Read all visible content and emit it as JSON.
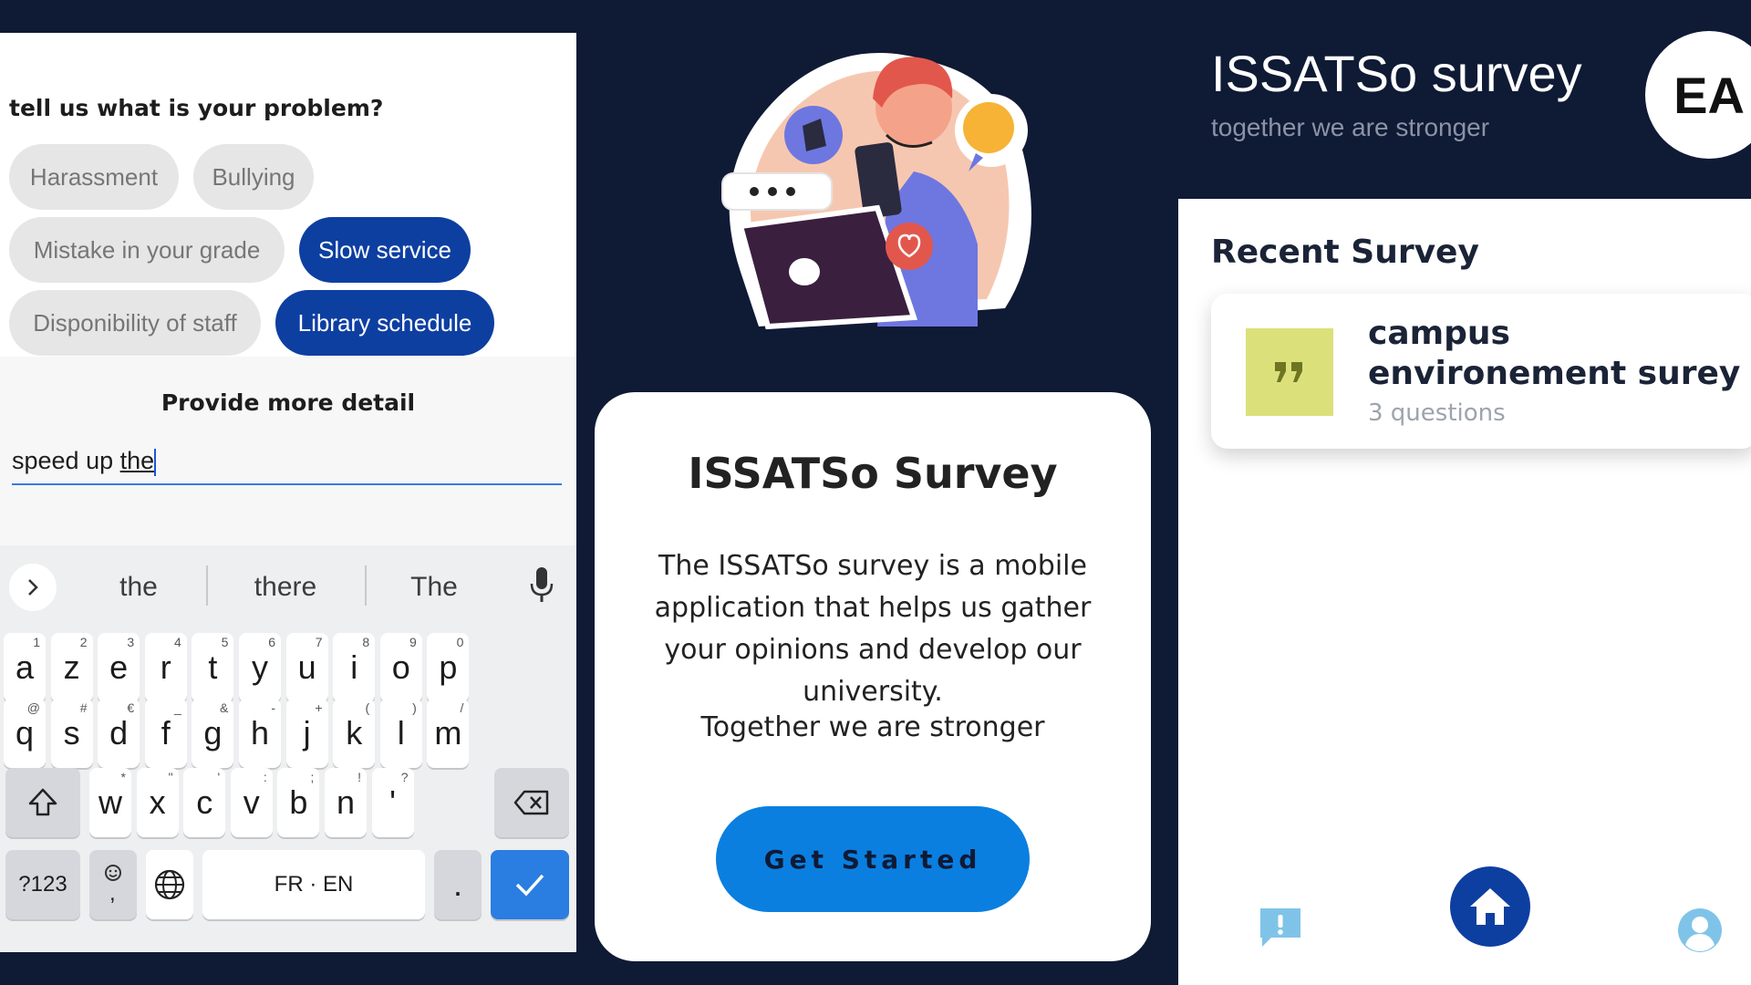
{
  "left": {
    "question": "tell us what is your problem?",
    "chips": [
      {
        "label": "Harassment",
        "selected": false
      },
      {
        "label": "Bullying",
        "selected": false
      },
      {
        "label": "Mistake in your grade",
        "selected": false
      },
      {
        "label": "Slow service",
        "selected": true
      },
      {
        "label": "Disponibility of staff",
        "selected": false
      },
      {
        "label": "Library schedule",
        "selected": true
      }
    ],
    "detail_title": "Provide more detail",
    "detail_value_prefix": "speed up ",
    "detail_value_word": "the",
    "keyboard": {
      "suggestions": [
        "the",
        "there",
        "The"
      ],
      "row1": [
        {
          "k": "a",
          "s": "1"
        },
        {
          "k": "z",
          "s": "2"
        },
        {
          "k": "e",
          "s": "3"
        },
        {
          "k": "r",
          "s": "4"
        },
        {
          "k": "t",
          "s": "5"
        },
        {
          "k": "y",
          "s": "6"
        },
        {
          "k": "u",
          "s": "7"
        },
        {
          "k": "i",
          "s": "8"
        },
        {
          "k": "o",
          "s": "9"
        },
        {
          "k": "p",
          "s": "0"
        }
      ],
      "row2": [
        {
          "k": "q",
          "s": "@"
        },
        {
          "k": "s",
          "s": "#"
        },
        {
          "k": "d",
          "s": "€"
        },
        {
          "k": "f",
          "s": "_"
        },
        {
          "k": "g",
          "s": "&"
        },
        {
          "k": "h",
          "s": "-"
        },
        {
          "k": "j",
          "s": "+"
        },
        {
          "k": "k",
          "s": "("
        },
        {
          "k": "l",
          "s": ")"
        },
        {
          "k": "m",
          "s": "/"
        }
      ],
      "row3": [
        {
          "k": "w",
          "s": "*"
        },
        {
          "k": "x",
          "s": "\""
        },
        {
          "k": "c",
          "s": "'"
        },
        {
          "k": "v",
          "s": ":"
        },
        {
          "k": "b",
          "s": ";"
        },
        {
          "k": "n",
          "s": "!"
        },
        {
          "k": "'",
          "s": "?"
        }
      ],
      "num_label": "?123",
      "space_label": "FR · EN",
      "period_label": "."
    }
  },
  "middle": {
    "title": "ISSATSo Survey",
    "description": "The ISSATSo survey is a mobile application that helps us gather your opinions and develop our university.",
    "tagline": "Together we are stronger",
    "button_label": "Get Started"
  },
  "right": {
    "app_title": "ISSATSo survey",
    "app_subtitle": "together we are stronger",
    "avatar_initials": "EA",
    "section_title": "Recent Survey",
    "survey": {
      "name": "campus environement surey",
      "count": "3 questions"
    }
  },
  "colors": {
    "background": "#0f1a35",
    "accent": "#0d3fa1",
    "button": "#0a7fe0",
    "quote_tile": "#dbe07a"
  }
}
